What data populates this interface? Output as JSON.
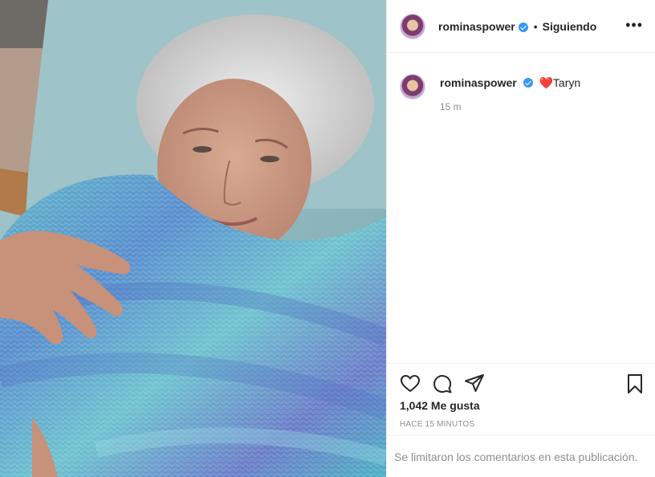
{
  "post": {
    "username": "rominaspower",
    "separator": "•",
    "follow_status": "Siguiendo",
    "more_label": "•••"
  },
  "caption": {
    "username": "rominaspower",
    "emoji": "❤️",
    "text": "Taryn",
    "time": "15 m"
  },
  "icons": {
    "like": "heart-outline-icon",
    "comment": "comment-bubble-icon",
    "share": "paper-plane-icon",
    "save": "bookmark-icon",
    "verified": "verified-badge-icon"
  },
  "stats": {
    "likes": "1,042 Me gusta",
    "posted": "HACE 15 MINUTOS"
  },
  "comments_notice": "Se limitaron los comentarios en esta publicación.",
  "colors": {
    "verified_blue": "#3897f0",
    "text_primary": "#262626",
    "text_secondary": "#8e8e8e",
    "divider": "#efefef"
  }
}
